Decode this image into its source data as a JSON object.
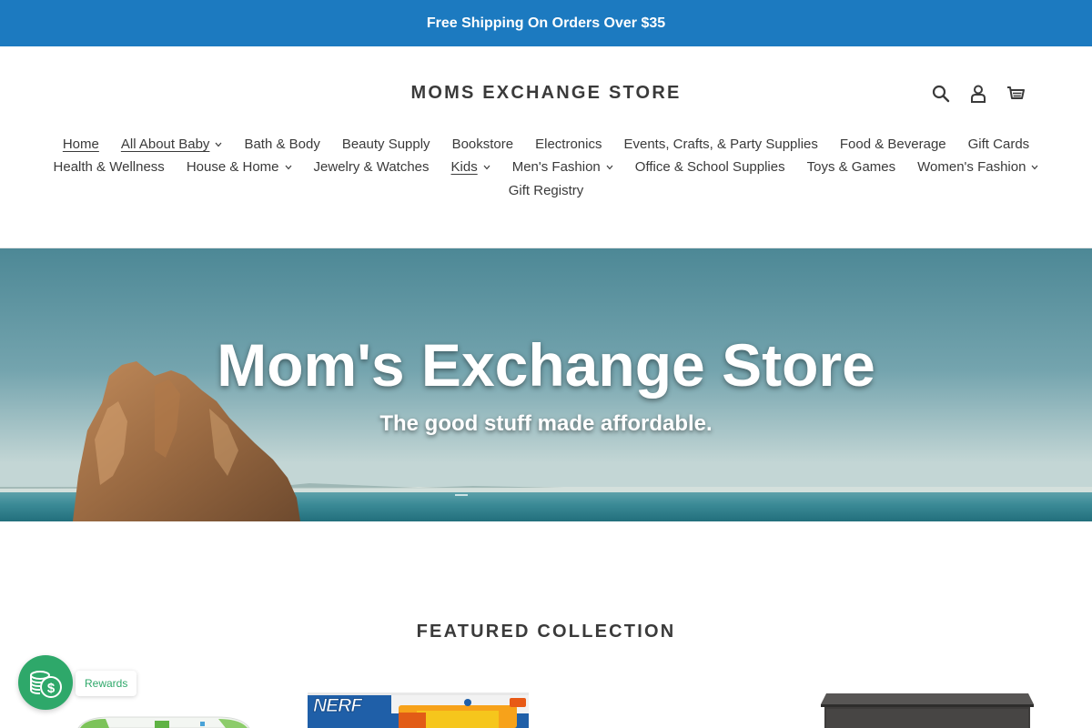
{
  "announcement": {
    "text": "Free Shipping On Orders Over $35"
  },
  "header": {
    "logo": "MOMS EXCHANGE STORE",
    "icons": [
      "search-icon",
      "account-icon",
      "cart-icon"
    ]
  },
  "nav": {
    "row1": [
      {
        "label": "Home",
        "active": true,
        "dropdown": false
      },
      {
        "label": "All About Baby",
        "active": true,
        "dropdown": true
      },
      {
        "label": "Bath & Body",
        "dropdown": false
      },
      {
        "label": "Beauty Supply",
        "dropdown": false
      },
      {
        "label": "Bookstore",
        "dropdown": false
      },
      {
        "label": "Electronics",
        "dropdown": false
      },
      {
        "label": "Events, Crafts, & Party Supplies",
        "dropdown": false
      },
      {
        "label": "Food & Beverage",
        "dropdown": false
      },
      {
        "label": "Gift Cards",
        "dropdown": false
      }
    ],
    "row2": [
      {
        "label": "Health & Wellness",
        "dropdown": false
      },
      {
        "label": "House & Home",
        "dropdown": true
      },
      {
        "label": "Jewelry & Watches",
        "dropdown": false
      },
      {
        "label": "Kids",
        "active": true,
        "dropdown": true
      },
      {
        "label": "Men's Fashion",
        "dropdown": true
      },
      {
        "label": "Office & School Supplies",
        "dropdown": false
      },
      {
        "label": "Toys & Games",
        "dropdown": false
      },
      {
        "label": "Women's Fashion",
        "dropdown": true
      }
    ],
    "row3": [
      {
        "label": "Gift Registry",
        "dropdown": false
      }
    ]
  },
  "hero": {
    "title": "Mom's Exchange Store",
    "subtitle": "The good stuff made affordable."
  },
  "featured": {
    "title": "FEATURED COLLECTION"
  },
  "products": [
    {
      "brand_text": ""
    },
    {
      "brand_text": "NERF"
    },
    {
      "brand_text": ""
    }
  ],
  "rewards": {
    "label": "Rewards"
  },
  "colors": {
    "announcement_bg": "#1c7ac0",
    "rewards_green": "#2ea86a",
    "text": "#3a3a3a"
  }
}
